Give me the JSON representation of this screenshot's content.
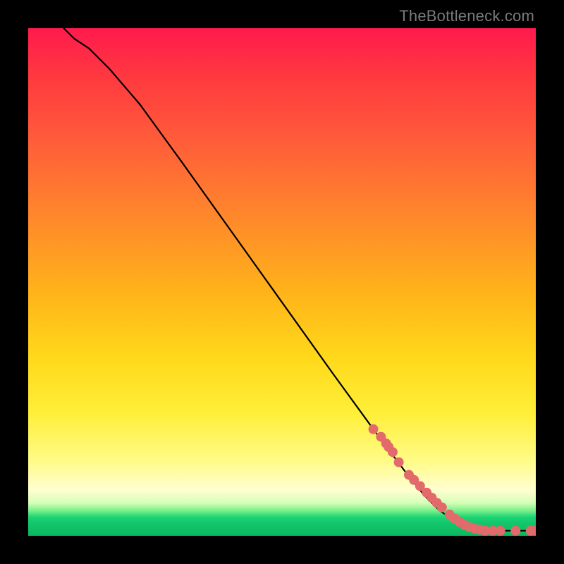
{
  "watermark": "TheBottleneck.com",
  "chart_data": {
    "type": "line",
    "title": "",
    "xlabel": "",
    "ylabel": "",
    "xlim": [
      0,
      100
    ],
    "ylim": [
      0,
      100
    ],
    "series": [
      {
        "name": "curve",
        "color": "#000000",
        "x": [
          7,
          9,
          12,
          16,
          22,
          30,
          40,
          50,
          60,
          68,
          74,
          78,
          81,
          84,
          86,
          88,
          90,
          93,
          96,
          100
        ],
        "y": [
          100,
          98,
          96,
          92,
          85,
          74,
          60,
          46,
          32,
          21,
          13,
          8,
          5,
          3,
          2,
          1.5,
          1,
          1,
          1,
          1
        ]
      },
      {
        "name": "markers",
        "color": "#e26a6a",
        "x": [
          68,
          69.5,
          70.5,
          71,
          71.8,
          73,
          75,
          76,
          77.2,
          78.5,
          79.5,
          80.5,
          81.5,
          83,
          84,
          85,
          86,
          87,
          88,
          89,
          90,
          91.5,
          93,
          96,
          99,
          100
        ],
        "y": [
          21,
          19.5,
          18.2,
          17.5,
          16.5,
          14.5,
          12,
          11,
          9.8,
          8.5,
          7.5,
          6.5,
          5.6,
          4.2,
          3.4,
          2.7,
          2.1,
          1.7,
          1.4,
          1.2,
          1,
          1,
          1,
          1,
          1,
          1
        ]
      }
    ]
  }
}
